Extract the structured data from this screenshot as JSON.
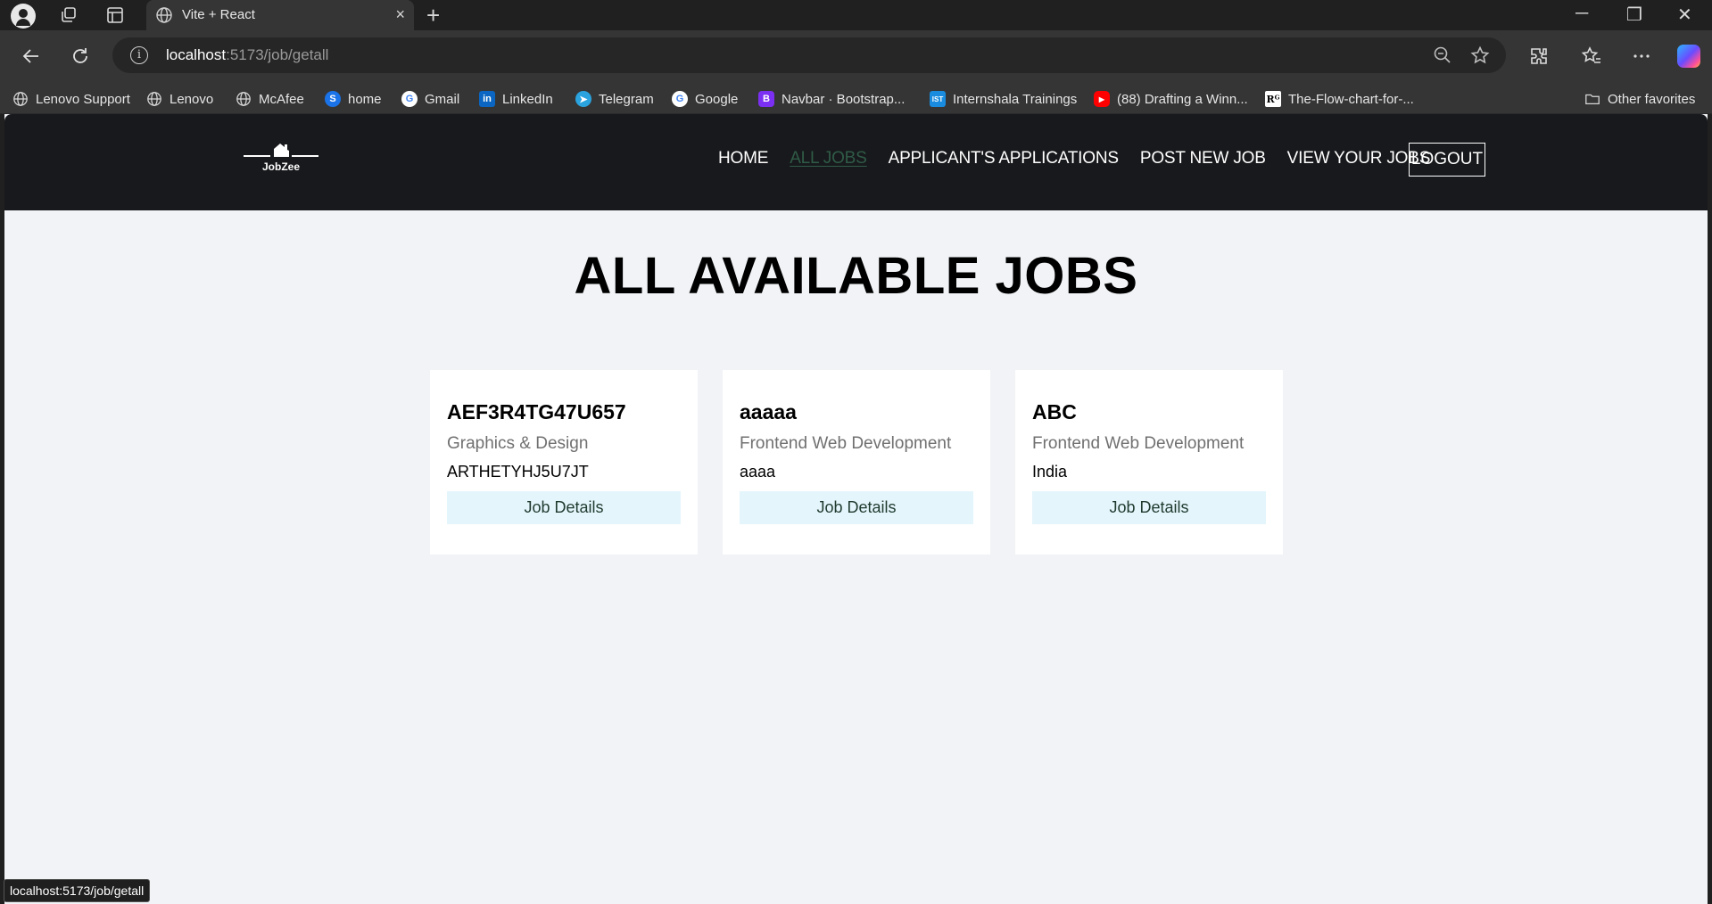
{
  "browser": {
    "tab_title": "Vite + React",
    "new_tab_symbol": "+",
    "close_symbol": "×",
    "url_host": "localhost",
    "url_path": ":5173/job/getall",
    "status_url": "localhost:5173/job/getall",
    "window_controls": {
      "minimize": "─",
      "restore": "❐",
      "close": "✕"
    },
    "bookmarks": [
      {
        "label": "Lenovo Support",
        "icon": "globe-icon"
      },
      {
        "label": "Lenovo",
        "icon": "globe-icon"
      },
      {
        "label": "McAfee",
        "icon": "globe-icon"
      },
      {
        "label": "home",
        "icon": "s-icon",
        "color": "#1a73e8"
      },
      {
        "label": "Gmail",
        "icon": "google-icon"
      },
      {
        "label": "LinkedIn",
        "icon": "linkedin-icon",
        "color": "#0a66c2"
      },
      {
        "label": "Telegram",
        "icon": "telegram-icon",
        "color": "#2aa3df"
      },
      {
        "label": "Google",
        "icon": "google-icon"
      },
      {
        "label": "Navbar · Bootstrap...",
        "icon": "bootstrap-icon",
        "color": "#7b2ff2"
      },
      {
        "label": "Internshala Trainings",
        "icon": "ist-icon",
        "color": "#1a8cdf"
      },
      {
        "label": "(88) Drafting a Winn...",
        "icon": "youtube-icon",
        "color": "#ff0000"
      },
      {
        "label": "The-Flow-chart-for-...",
        "icon": "rg-icon",
        "color": "#ffffff"
      }
    ],
    "other_favorites": "Other favorites"
  },
  "app": {
    "logo_text": "JobZee",
    "nav": {
      "home": "HOME",
      "all_jobs": "ALL JOBS",
      "applications": "APPLICANT'S APPLICATIONS",
      "post_job": "POST NEW JOB",
      "view_jobs": "VIEW YOUR JOBS",
      "logout": "LOGOUT"
    },
    "page_title": "ALL AVAILABLE JOBS",
    "jobs": [
      {
        "title": "AEF3R4TG47U657",
        "category": "Graphics & Design",
        "country": "ARTHETYHJ5U7JT",
        "button": "Job Details"
      },
      {
        "title": "aaaaa",
        "category": "Frontend Web Development",
        "country": "aaaa",
        "button": "Job Details"
      },
      {
        "title": "ABC",
        "category": "Frontend Web Development",
        "country": "India",
        "button": "Job Details"
      }
    ]
  }
}
